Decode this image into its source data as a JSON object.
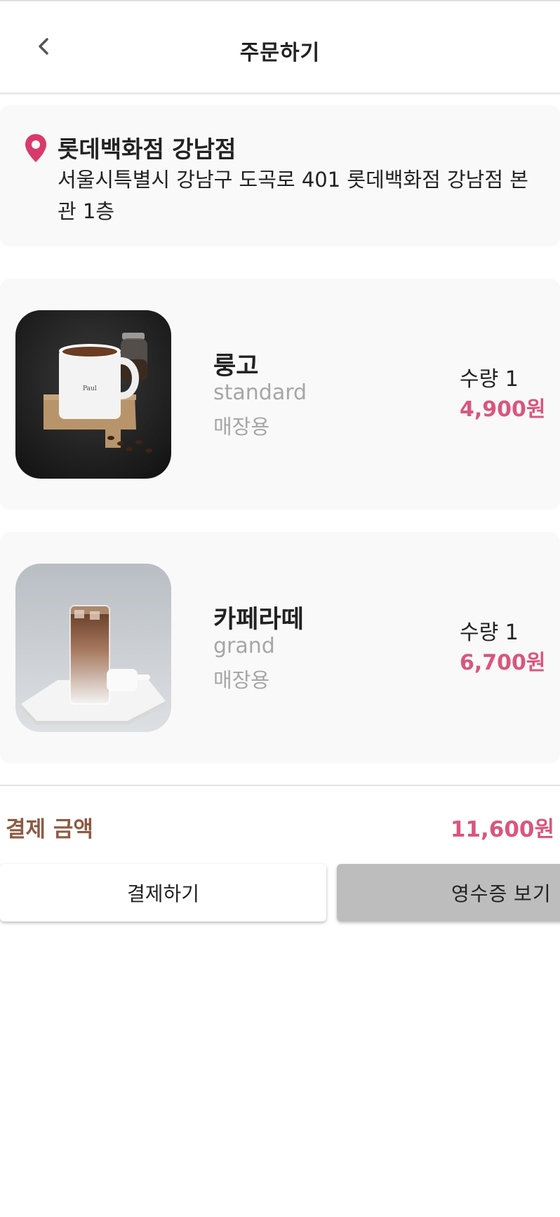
{
  "header": {
    "title": "주문하기",
    "back_icon": "chevron-left-icon"
  },
  "store": {
    "icon": "location-pin-icon",
    "pin_color": "#d93a6a",
    "name": "롯데백화점 강남점",
    "address": "서울시특별시 강남구 도곡로 401 롯데백화점 강남점 본관 1층"
  },
  "items": [
    {
      "name": "룽고",
      "size": "standard",
      "take": "매장용",
      "qty_label": "수량 1",
      "price": "4,900원",
      "image": "hot-coffee-mug-image"
    },
    {
      "name": "카페라떼",
      "size": "grand",
      "take": "매장용",
      "qty_label": "수량 1",
      "price": "6,700원",
      "image": "iced-latte-glass-image"
    }
  ],
  "total": {
    "label": "결제 금액",
    "value": "11,600원"
  },
  "actions": {
    "pay_label": "결제하기",
    "receipt_label": "영수증 보기"
  },
  "colors": {
    "accent_price": "#d9567d",
    "total_label": "#8b5a43",
    "card_bg": "#f9f9f9",
    "receipt_button": "#bdbdbd"
  }
}
